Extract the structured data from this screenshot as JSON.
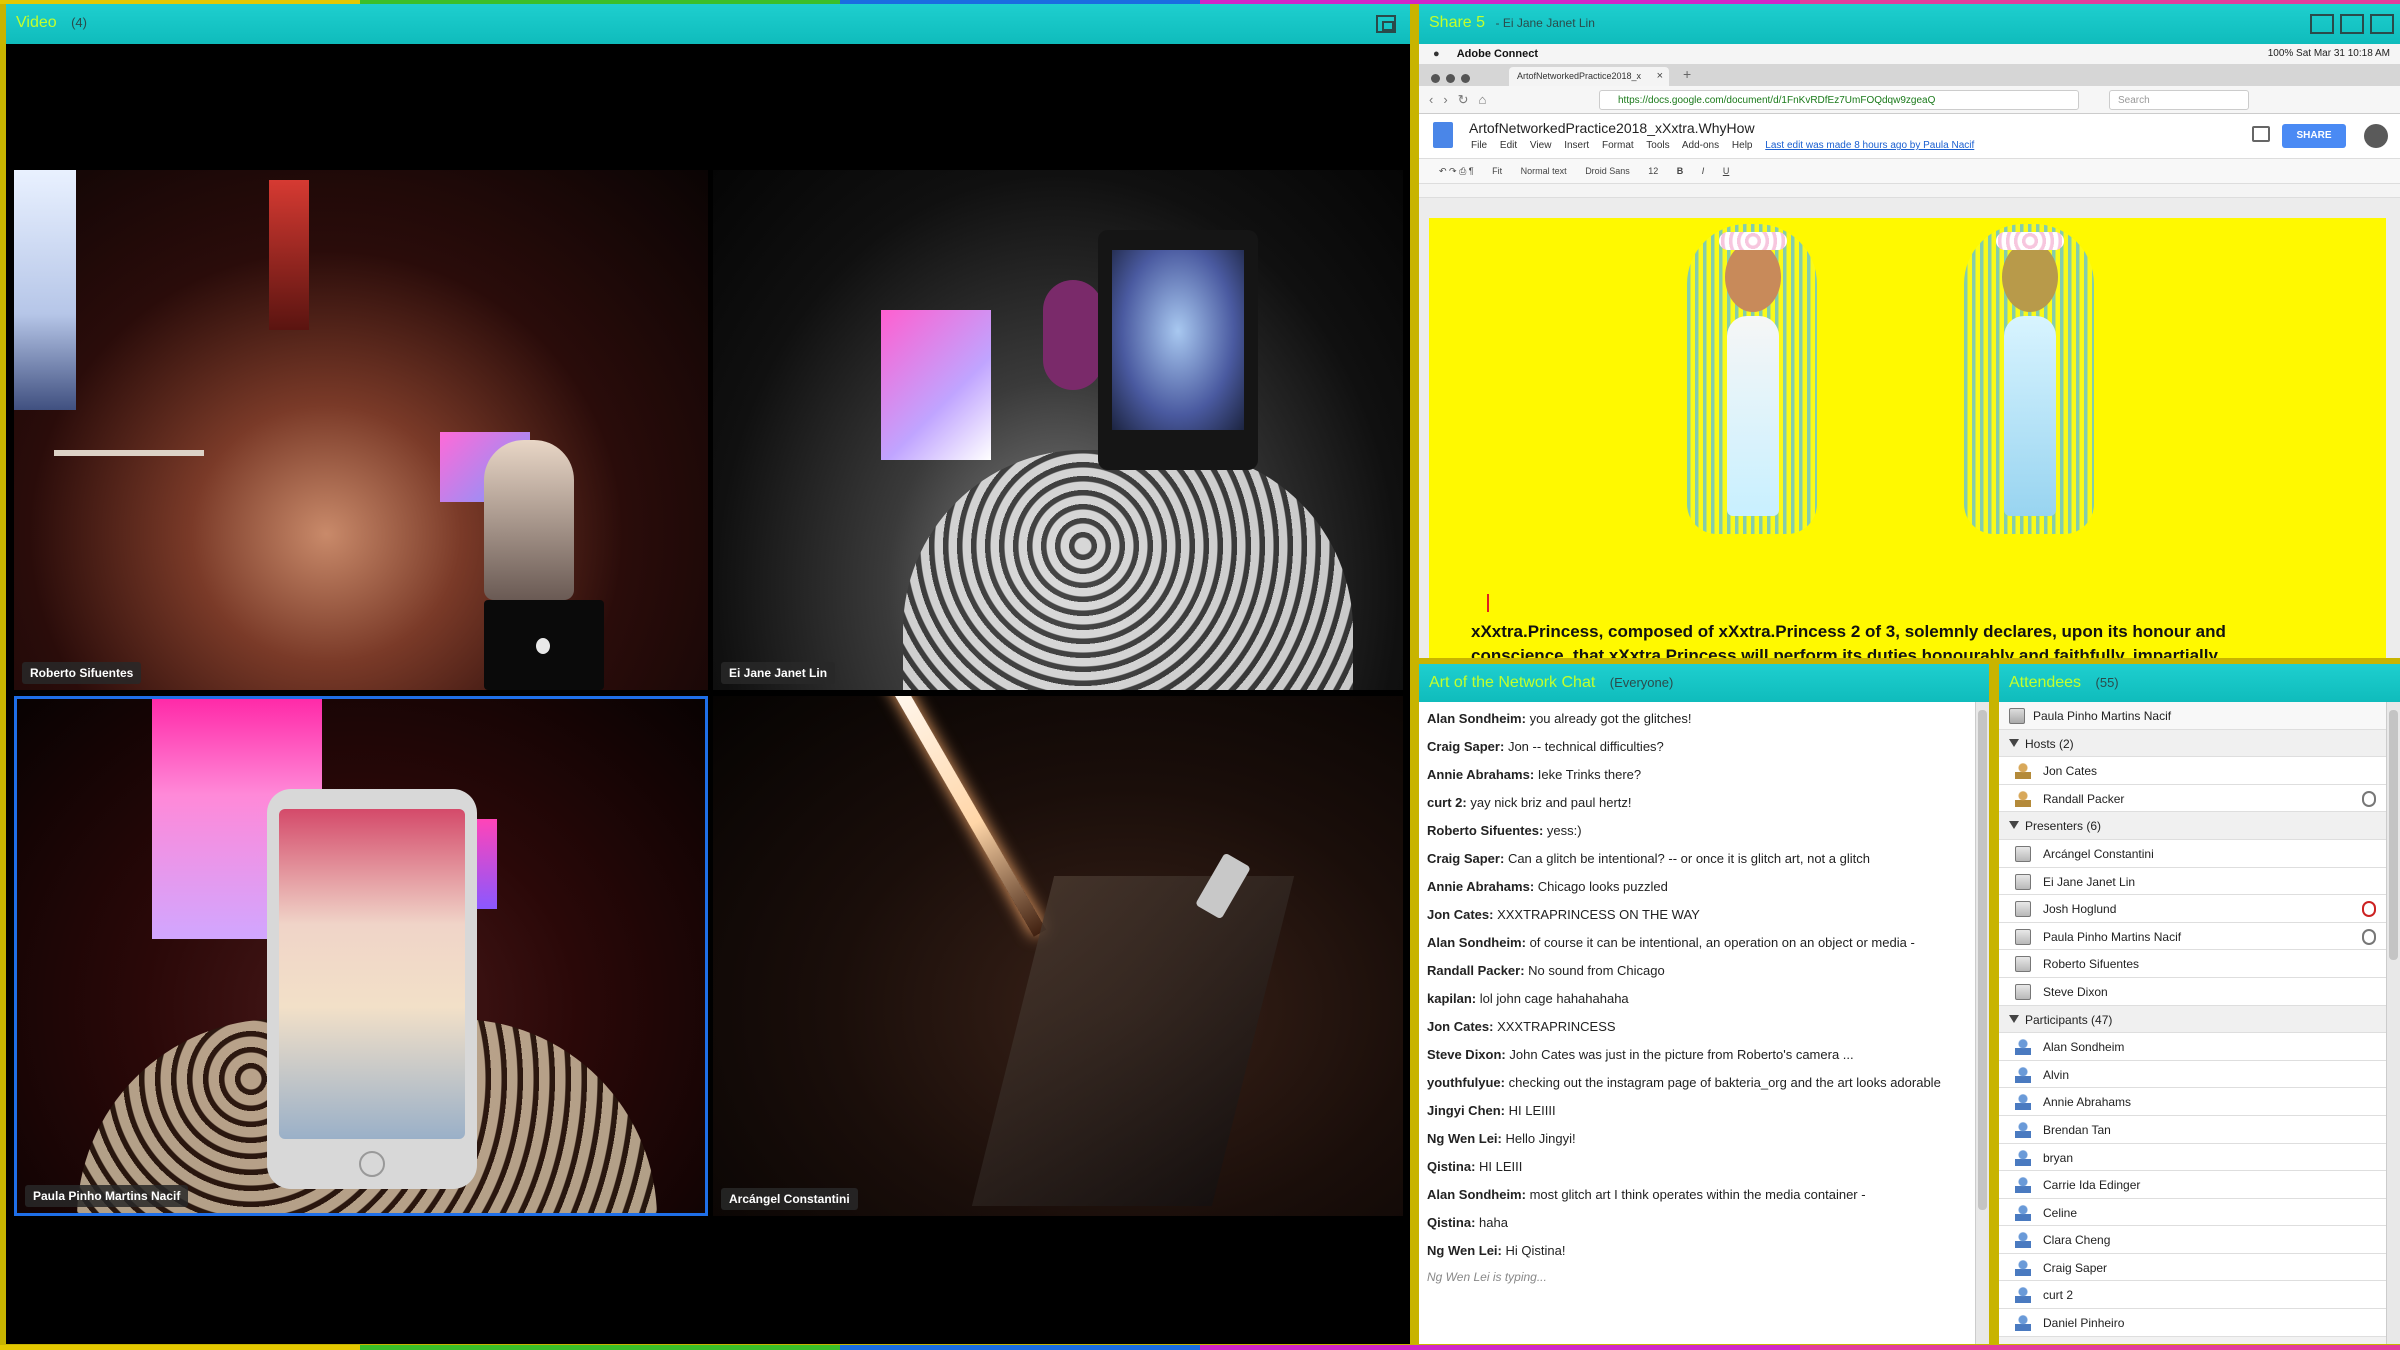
{
  "video": {
    "title": "Video",
    "count": "(4)",
    "tiles": [
      {
        "name": "Roberto Sifuentes"
      },
      {
        "name": "Ei Jane Janet Lin"
      },
      {
        "name": "Paula Pinho Martins Nacif"
      },
      {
        "name": "Arcángel Constantini"
      }
    ]
  },
  "share": {
    "title": "Share 5",
    "presenter": "- Ei Jane Janet Lin",
    "menubar": {
      "app": "Adobe Connect",
      "status": "100%   Sat Mar 31  10:18 AM"
    },
    "tab_title": "ArtofNetworkedPractice2018_x",
    "url": "https://docs.google.com/document/d/1FnKvRDfEz7UmFOQdqw9zgeaQ",
    "search_placeholder": "Search",
    "doc": {
      "title": "ArtofNetworkedPractice2018_xXxtra.WhyHow",
      "menu": [
        "File",
        "Edit",
        "View",
        "Insert",
        "Format",
        "Tools",
        "Add-ons",
        "Help"
      ],
      "last_edit": "Last edit was made 8 hours ago by Paula Nacif",
      "share_label": "SHARE",
      "toolbar": [
        "Fit",
        "Normal text",
        "Droid Sans",
        "12"
      ],
      "body_text": "xXxtra.Princess, composed of xXxtra.Princess 2 of 3, solemnly declares, upon its honour and conscience, that xXxtra.Princess will perform its duties honourably and faithfully, impartially"
    }
  },
  "chat": {
    "title": "Art of the Network Chat",
    "scope": "(Everyone)",
    "messages": [
      {
        "author": "Alan Sondheim:",
        "text": "you already got the glitches!"
      },
      {
        "author": "Craig Saper:",
        "text": "Jon -- technical difficulties?"
      },
      {
        "author": "Annie Abrahams:",
        "text": "Ieke Trinks there?"
      },
      {
        "author": "curt 2:",
        "text": "yay nick briz and paul hertz!"
      },
      {
        "author": "Roberto Sifuentes:",
        "text": "yess:)"
      },
      {
        "author": "Craig Saper:",
        "text": "Can a glitch be intentional? -- or once it is glitch art, not a glitch"
      },
      {
        "author": "Annie Abrahams:",
        "text": "Chicago looks puzzled"
      },
      {
        "author": "Jon Cates:",
        "text": "XXXTRAPRINCESS ON THE WAY"
      },
      {
        "author": "Alan Sondheim:",
        "text": "of course it can be intentional, an operation on an object or media -"
      },
      {
        "author": "Randall Packer:",
        "text": "No sound from Chicago"
      },
      {
        "author": "kapilan:",
        "text": "lol john cage hahahahaha"
      },
      {
        "author": "Jon Cates:",
        "text": "XXXTRAPRINCESS"
      },
      {
        "author": "Steve Dixon:",
        "text": "John Cates was just in the picture from Roberto's camera ..."
      },
      {
        "author": "youthfulyue:",
        "text": "checking out the instagram page of bakteria_org and the art looks adorable"
      },
      {
        "author": "Jingyi Chen:",
        "text": "HI LEIIII"
      },
      {
        "author": "Ng Wen Lei:",
        "text": "Hello Jingyi!"
      },
      {
        "author": "Qistina:",
        "text": "HI LEIII"
      },
      {
        "author": "Alan Sondheim:",
        "text": "most glitch art I think operates within the media container -"
      },
      {
        "author": "Qistina:",
        "text": "haha"
      },
      {
        "author": "Ng Wen Lei:",
        "text": "Hi Qistina!"
      }
    ],
    "typing": "Ng Wen Lei is typing..."
  },
  "attendees": {
    "title": "Attendees",
    "count": "(55)",
    "me": "Paula Pinho Martins Nacif",
    "hosts": {
      "label": "Hosts (2)",
      "items": [
        "Jon Cates",
        "Randall Packer"
      ]
    },
    "presenters": {
      "label": "Presenters (6)",
      "items": [
        "Arcángel Constantini",
        "Ei Jane Janet Lin",
        "Josh Hoglund",
        "Paula Pinho Martins Nacif",
        "Roberto Sifuentes",
        "Steve Dixon"
      ]
    },
    "participants": {
      "label": "Participants (47)",
      "items": [
        "Alan Sondheim",
        "Alvin",
        "Annie Abrahams",
        "Brendan Tan",
        "bryan",
        "Carrie Ida Edinger",
        "Celine",
        "Clara Cheng",
        "Craig Saper",
        "curt 2",
        "Daniel Pinheiro"
      ]
    }
  }
}
